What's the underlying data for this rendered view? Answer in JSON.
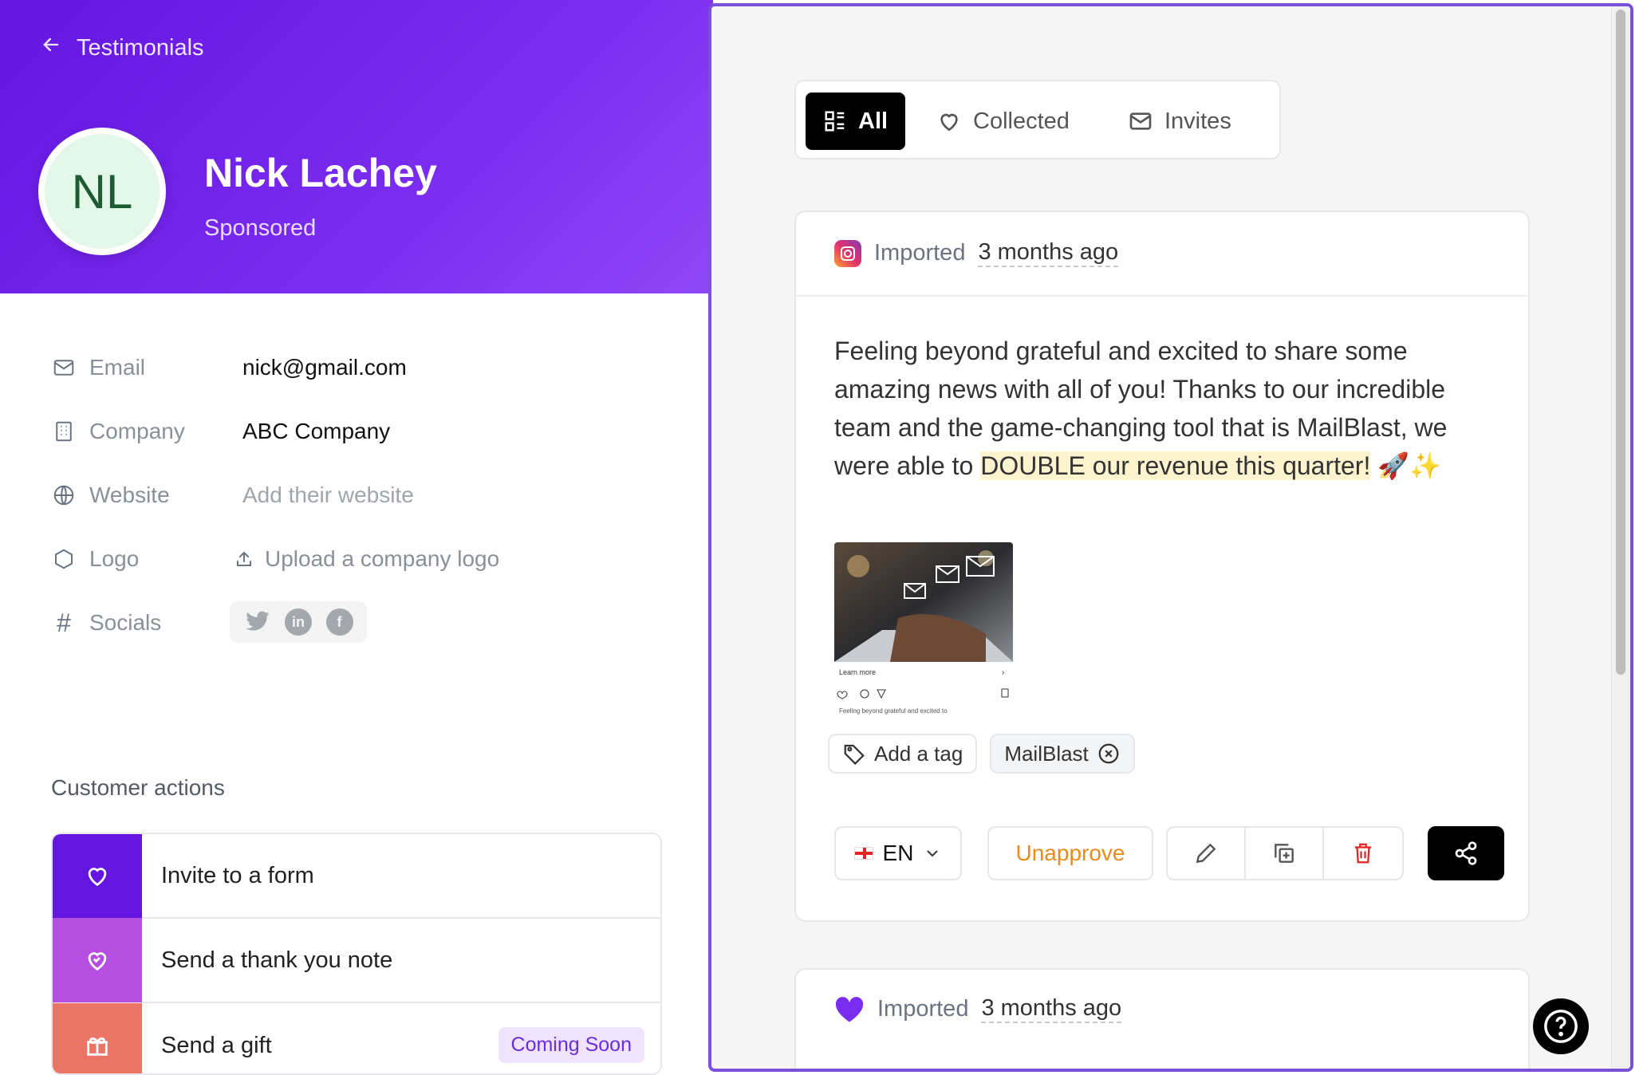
{
  "nav": {
    "back_label": "Testimonials"
  },
  "profile": {
    "initials": "NL",
    "name": "Nick Lachey",
    "status": "Sponsored"
  },
  "fields": [
    {
      "label": "Email",
      "value": "nick@gmail.com"
    },
    {
      "label": "Company",
      "value": "ABC Company"
    },
    {
      "label": "Website",
      "value": "Add their website"
    },
    {
      "label": "Logo",
      "value": "Upload a company logo"
    },
    {
      "label": "Socials",
      "value": ""
    }
  ],
  "customer_actions": {
    "title": "Customer actions",
    "items": [
      {
        "label": "Invite to a form",
        "color": "#6415e2"
      },
      {
        "label": "Send a thank you note",
        "color": "#b44fe2"
      },
      {
        "label": "Send a gift",
        "color": "#ea7565",
        "badge": "Coming Soon"
      }
    ]
  },
  "tabs": [
    {
      "label": "All",
      "icon": "grid-icon"
    },
    {
      "label": "Collected",
      "icon": "heart-icon"
    },
    {
      "label": "Invites",
      "icon": "mail-icon"
    }
  ],
  "testimonial1": {
    "source": "instagram-icon",
    "imported_label": "Imported",
    "time": "3 months ago",
    "text_before": "Feeling beyond grateful and excited to share some amazing news with all of you! Thanks to our incredible team and the game-changing tool that is MailBlast, we were able to ",
    "text_highlight": "DOUBLE our revenue this quarter!",
    "text_after": " 🚀✨",
    "thumb_caption": "Learn more",
    "thumb_text": "Feeling beyond grateful and excited to",
    "add_tag_label": "Add a tag",
    "tags": [
      "MailBlast"
    ],
    "language": "EN",
    "unapprove_label": "Unapprove"
  },
  "testimonial2": {
    "imported_label": "Imported",
    "time": "3 months ago"
  },
  "colors": {
    "accent": "#6415e2",
    "unapprove": "#e88b1e",
    "delete": "#e02424"
  }
}
